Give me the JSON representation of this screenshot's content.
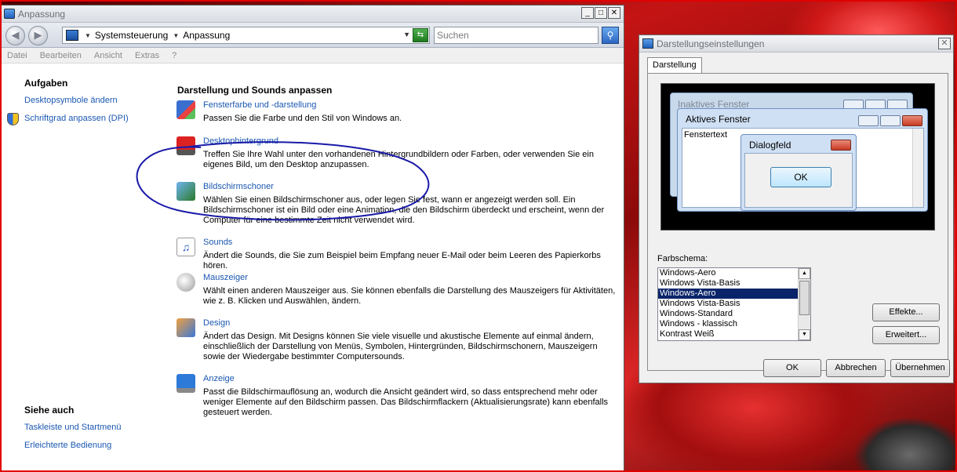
{
  "main_window": {
    "title": "Anpassung",
    "minimize": "_",
    "maximize": "□",
    "close": "✕"
  },
  "address": {
    "crumbs": [
      "Systemsteuerung",
      "Anpassung"
    ],
    "search_placeholder": "Suchen"
  },
  "menu": [
    "Datei",
    "Bearbeiten",
    "Ansicht",
    "Extras",
    "?"
  ],
  "sidebar": {
    "tasks_heading": "Aufgaben",
    "tasks": [
      "Desktopsymbole ändern",
      "Schriftgrad anpassen (DPI)"
    ],
    "see_also_heading": "Siehe auch",
    "see_also": [
      "Taskleiste und Startmenü",
      "Erleichterte Bedienung"
    ]
  },
  "main": {
    "heading": "Darstellung und Sounds anpassen",
    "items": [
      {
        "link": "Fensterfarbe und -darstellung",
        "desc": "Passen Sie die Farbe und den Stil von Windows an.",
        "icon": "window-color-icon"
      },
      {
        "link": "Desktophintergrund",
        "desc": "Treffen Sie Ihre Wahl unter den vorhandenen Hintergrundbildern oder Farben, oder verwenden Sie ein eigenes Bild, um den Desktop anzupassen.",
        "icon": "desktop-background-icon"
      },
      {
        "link": "Bildschirmschoner",
        "desc": "Wählen Sie einen Bildschirmschoner aus, oder legen Sie fest, wann er angezeigt werden soll. Ein Bildschirmschoner ist ein Bild oder eine Animation, die den Bildschirm überdeckt und erscheint, wenn der Computer für eine bestimmte Zeit nicht verwendet wird.",
        "icon": "screensaver-icon"
      },
      {
        "link": "Sounds",
        "desc": "Ändert die Sounds, die Sie zum Beispiel beim Empfang neuer E-Mail oder beim Leeren des Papierkorbs hören.",
        "icon": "sounds-icon"
      },
      {
        "link": "Mauszeiger",
        "desc": "Wählt einen anderen Mauszeiger aus. Sie können ebenfalls die Darstellung des Mauszeigers für Aktivitäten, wie z. B. Klicken und Auswählen, ändern.",
        "icon": "mouse-pointer-icon"
      },
      {
        "link": "Design",
        "desc": "Ändert das Design. Mit Designs können Sie viele visuelle und akustische Elemente auf einmal ändern, einschließlich der Darstellung von Menüs, Symbolen, Hintergründen, Bildschirmschonern, Mauszeigern sowie der Wiedergabe bestimmter Computersounds.",
        "icon": "theme-icon"
      },
      {
        "link": "Anzeige",
        "desc": "Passt die Bildschirmauflösung an, wodurch die Ansicht geändert wird, so dass entsprechend mehr oder weniger Elemente auf den Bildschirm passen. Das Bildschirmflackern (Aktualisierungsrate) kann ebenfalls gesteuert werden.",
        "icon": "display-icon"
      }
    ]
  },
  "dialog": {
    "title": "Darstellungseinstellungen",
    "tab": "Darstellung",
    "preview": {
      "inactive": "Inaktives Fenster",
      "active": "Aktives Fenster",
      "window_text": "Fenstertext",
      "message_box": "Dialogfeld",
      "ok": "OK"
    },
    "scheme_label": "Farbschema:",
    "schemes": [
      "Windows-Aero",
      "Windows Vista-Basis",
      "Windows-Aero",
      "Windows Vista-Basis",
      "Windows-Standard",
      "Windows - klassisch",
      "Kontrast Weiß"
    ],
    "selected_index": 2,
    "effects_button": "Effekte...",
    "advanced_button": "Erweitert...",
    "ok_button": "OK",
    "cancel_button": "Abbrechen",
    "apply_button": "Übernehmen"
  },
  "colors": {
    "link": "#1b57b1",
    "selection": "#0a246a",
    "annotation": "#1a1aa8"
  }
}
